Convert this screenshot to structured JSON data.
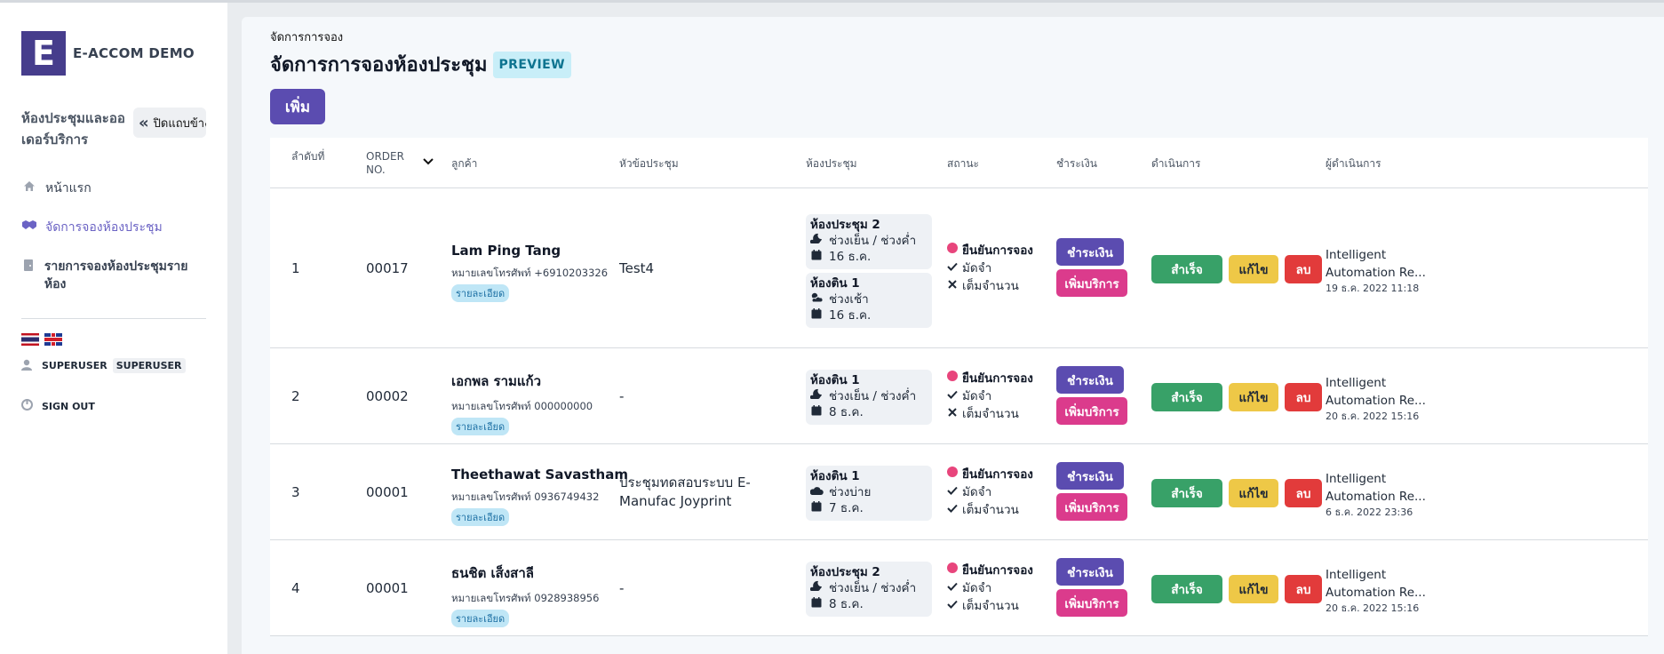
{
  "app": {
    "logo_letter": "E",
    "name": "E-ACCOM DEMO"
  },
  "sidebar": {
    "module_title": "ห้องประชุมและออเดอร์บริการ",
    "collapse_label": "ปิดแถบข้าง",
    "nav": {
      "home": "หน้าแรก",
      "booking": "จัดการจองห้องประชุม",
      "report": "รายการจองห้องประชุมรายห้อง"
    },
    "user": {
      "name": "SUPERUSER",
      "role": "SUPERUSER"
    },
    "sign_out": "SIGN OUT"
  },
  "page": {
    "breadcrumb": "จัดการการจอง",
    "title": "จัดการการจองห้องประชุม",
    "preview_badge": "PREVIEW",
    "add_button": "เพิ่ม"
  },
  "table": {
    "headers": {
      "seq": "ลำดับที่",
      "order": "ORDER NO.",
      "customer": "ลูกค้า",
      "topic": "หัวข้อประชุม",
      "room": "ห้องประชุม",
      "status": "สถานะ",
      "payment": "ชำระเงิน",
      "action": "ดำเนินการ",
      "operator": "ผู้ดำเนินการ"
    },
    "detail_label": "รายละเอียด",
    "status_labels": {
      "confirmed": "ยืนยันการจอง",
      "deposit": "มัดจำ",
      "full": "เต็มจำนวน"
    },
    "payment_labels": {
      "pay": "ชำระเงิน",
      "add_service": "เพิ่มบริการ"
    },
    "action_labels": {
      "ok": "สำเร็จ",
      "edit": "แก้ไข",
      "delete": "ลบ"
    },
    "rows": [
      {
        "seq": "1",
        "order": "00017",
        "customer": "Lam Ping Tang",
        "phone": "หมายเลขโทรศัพท์ +6910203326",
        "topic": "Test4",
        "rooms": [
          {
            "name": "ห้องประชุม 2",
            "slot": "ช่วงเย็น / ช่วงค่ำ",
            "slot_icon": "moon-cloud-icon",
            "date": "16 ธ.ค."
          },
          {
            "name": "ห้องติน 1",
            "slot": "ช่วงเช้า",
            "slot_icon": "sun-cloud-icon",
            "date": "16 ธ.ค."
          }
        ],
        "full_paid": false,
        "operator_name": "Intelligent",
        "operator_name2": "Automation Re...",
        "operator_time": "19 ธ.ค. 2022 11:18"
      },
      {
        "seq": "2",
        "order": "00002",
        "customer": "เอกพล รามแก้ว",
        "phone": "หมายเลขโทรศัพท์ 000000000",
        "topic": "-",
        "rooms": [
          {
            "name": "ห้องติน 1",
            "slot": "ช่วงเย็น / ช่วงค่ำ",
            "slot_icon": "moon-cloud-icon",
            "date": "8 ธ.ค."
          }
        ],
        "full_paid": false,
        "operator_name": "Intelligent",
        "operator_name2": "Automation Re...",
        "operator_time": "20 ธ.ค. 2022 15:16"
      },
      {
        "seq": "3",
        "order": "00001",
        "customer": "Theethawat Savastham",
        "phone": "หมายเลขโทรศัพท์ 0936749432",
        "topic": "ประชุมทดสอบระบบ E-Manufac Joyprint",
        "rooms": [
          {
            "name": "ห้องติน 1",
            "slot": "ช่วงบ่าย",
            "slot_icon": "cloud-icon",
            "date": "7 ธ.ค."
          }
        ],
        "full_paid": true,
        "operator_name": "Intelligent",
        "operator_name2": "Automation Re...",
        "operator_time": "6 ธ.ค. 2022 23:36"
      },
      {
        "seq": "4",
        "order": "00001",
        "customer": "ธนชิต เส็งสาลี",
        "phone": "หมายเลขโทรศัพท์ 0928938956",
        "topic": "-",
        "rooms": [
          {
            "name": "ห้องประชุม 2",
            "slot": "ช่วงเย็น / ช่วงค่ำ",
            "slot_icon": "moon-cloud-icon",
            "date": "8 ธ.ค."
          }
        ],
        "full_paid": true,
        "operator_name": "Intelligent",
        "operator_name2": "Automation Re...",
        "operator_time": "20 ธ.ค. 2022 15:16"
      }
    ]
  },
  "colors": {
    "brand": "#463d8c",
    "pay_button": "#5b4cb0",
    "add_service_button": "#db3b8c",
    "success_button": "#38a168",
    "edit_button": "#eec847",
    "delete_button": "#e23b3b",
    "status_dot": "#e8457c"
  }
}
